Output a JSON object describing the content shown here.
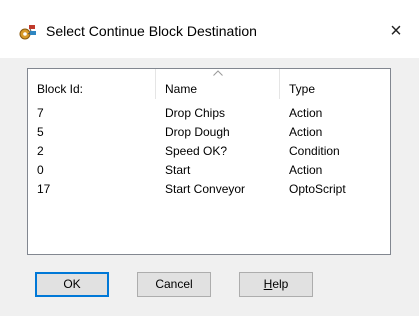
{
  "window": {
    "title": "Select Continue Block Destination",
    "close_glyph": "×",
    "icon": "gear-flowchart-icon"
  },
  "list": {
    "columns": [
      {
        "label": "Block Id:"
      },
      {
        "label": "Name",
        "sort_indicator": "ascending"
      },
      {
        "label": "Type"
      }
    ],
    "rows": [
      {
        "id": "7",
        "name": "Drop Chips",
        "type": "Action"
      },
      {
        "id": "5",
        "name": "Drop Dough",
        "type": "Action"
      },
      {
        "id": "2",
        "name": "Speed OK?",
        "type": "Condition"
      },
      {
        "id": "0",
        "name": "Start",
        "type": "Action"
      },
      {
        "id": "17",
        "name": "Start Conveyor",
        "type": "OptoScript"
      }
    ]
  },
  "buttons": {
    "ok": "OK",
    "cancel": "Cancel",
    "help_mnemonic": "H",
    "help_rest": "elp"
  },
  "colors": {
    "default_button_border": "#0078d7",
    "dialog_background": "#f0f0f0",
    "list_background": "#ffffff"
  }
}
